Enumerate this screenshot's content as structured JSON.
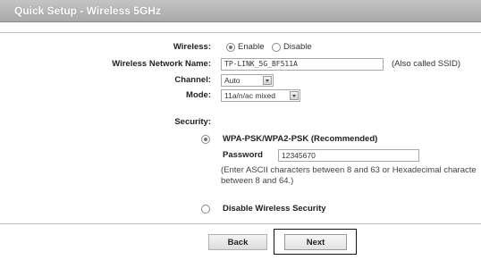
{
  "header": {
    "title": "Quick Setup - Wireless 5GHz"
  },
  "form": {
    "wireless": {
      "label": "Wireless:",
      "options": [
        "Enable",
        "Disable"
      ],
      "selected": "Enable"
    },
    "ssid": {
      "label": "Wireless Network Name:",
      "value": "TP-LINK_5G_BF511A",
      "note": "(Also called SSID)"
    },
    "channel": {
      "label": "Channel:",
      "value": "Auto"
    },
    "mode": {
      "label": "Mode:",
      "value": "11a/n/ac mixed"
    },
    "security": {
      "label": "Security:",
      "wpa_label": "WPA-PSK/WPA2-PSK (Recommended)",
      "password_label": "Password",
      "password_value": "12345670",
      "note_line1": "(Enter ASCII characters between 8 and 63 or Hexadecimal characte",
      "note_line2": "between 8 and 64.)",
      "disable_label": "Disable Wireless Security",
      "selected": "wpa"
    }
  },
  "buttons": {
    "back_label": "Back",
    "next_label": "Next"
  },
  "colors": {
    "titlebar": "#b3b3b3",
    "title_text": "#ffffff"
  }
}
